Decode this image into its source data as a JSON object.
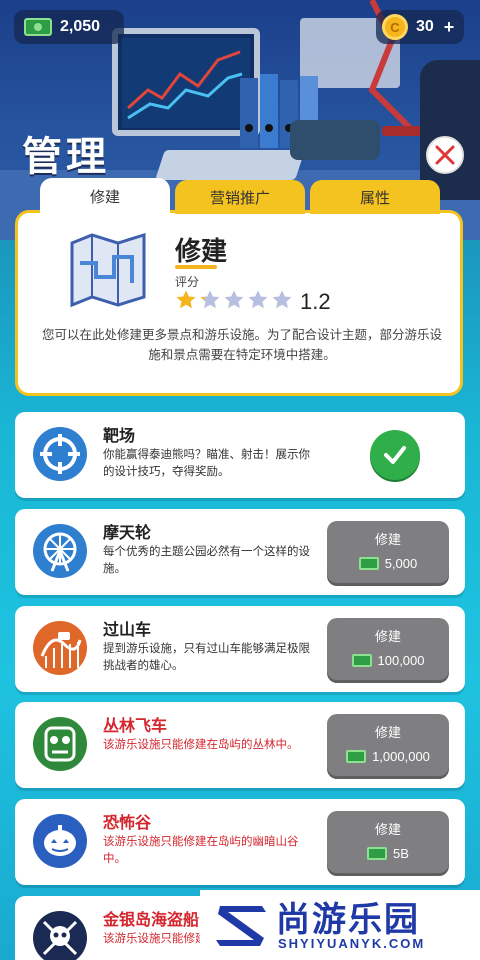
{
  "header": {
    "cash": "2,050",
    "coins": "30",
    "coins_plus": "+",
    "title": "管理"
  },
  "tabs": [
    {
      "label": "修建",
      "active": true
    },
    {
      "label": "营销推广",
      "active": false
    },
    {
      "label": "属性",
      "active": false
    }
  ],
  "info": {
    "title": "修建",
    "rating_label": "评分",
    "rating_value": "1.2",
    "rating_stars": 1.2,
    "rating_max": 5,
    "description": "您可以在此处修建更多景点和游乐设施。为了配合设计主题，部分游乐设施和景点需要在特定环境中搭建。"
  },
  "items": [
    {
      "name": "靶场",
      "desc": "你能赢得泰迪熊吗？瞄准、射击！展示你的设计技巧，夺得奖励。",
      "status": "built"
    },
    {
      "name": "摩天轮",
      "desc": "每个优秀的主题公园必然有一个这样的设施。",
      "button": "修建",
      "cost": "5,000"
    },
    {
      "name": "过山车",
      "desc": "提到游乐设施，只有过山车能够满足极限挑战者的雄心。",
      "button": "修建",
      "cost": "100,000"
    },
    {
      "name": "丛林飞车",
      "desc": "该游乐设施只能修建在岛屿的丛林中。",
      "button": "修建",
      "cost": "1,000,000",
      "locked": true
    },
    {
      "name": "恐怖谷",
      "desc": "该游乐设施只能修建在岛屿的幽暗山谷中。",
      "button": "修建",
      "cost": "5B",
      "locked": true
    },
    {
      "name": "金银岛海盗船",
      "desc": "该游乐设施只能修建在岛屿的海滩边。",
      "locked": true
    }
  ],
  "watermark": {
    "cn": "尚游乐园",
    "en": "SHYIYUANYK.COM"
  },
  "colors": {
    "accent_yellow": "#f4c320",
    "locked_red": "#d4262e",
    "built_green": "#2fae4a",
    "button_gray": "#7f7f82"
  }
}
